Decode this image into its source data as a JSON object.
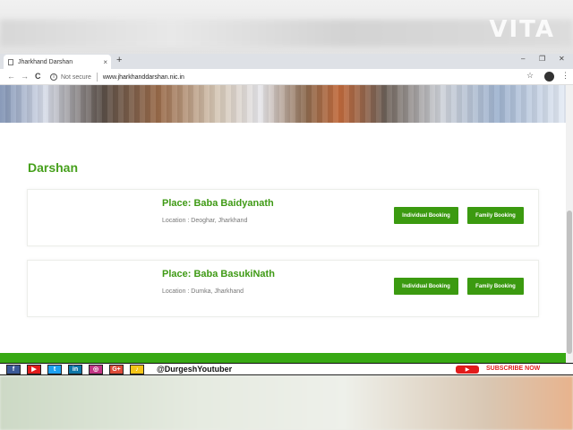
{
  "watermark": "VITA",
  "browser": {
    "tab_title": "Jharkhand Darshan",
    "tab_close": "×",
    "new_tab": "+",
    "win_min": "–",
    "win_max": "❐",
    "win_close": "✕",
    "back": "←",
    "forward": "→",
    "reload": "C",
    "info": "i",
    "security": "Not secure",
    "url": "www.jharkhanddarshan.nic.in",
    "bookmark": "☆",
    "menu": "⋮"
  },
  "page": {
    "section_title": "Darshan",
    "cards": [
      {
        "place": "Place: Baba Baidyanath",
        "location": "Location : Deoghar, Jharkhand",
        "individual_label": "Individual Booking",
        "family_label": "Family Booking"
      },
      {
        "place": "Place: Baba BasukiNath",
        "location": "Location : Dumka, Jharkhand",
        "individual_label": "Individual Booking",
        "family_label": "Family Booking"
      }
    ]
  },
  "social": {
    "icons": [
      {
        "name": "facebook-icon",
        "glyph": "f",
        "color": "#3b5998"
      },
      {
        "name": "youtube-icon",
        "glyph": "▶",
        "color": "#e21b1b"
      },
      {
        "name": "twitter-icon",
        "glyph": "t",
        "color": "#1da1f2"
      },
      {
        "name": "linkedin-icon",
        "glyph": "in",
        "color": "#0e76a8"
      },
      {
        "name": "instagram-icon",
        "glyph": "◎",
        "color": "#c13584"
      },
      {
        "name": "googleplus-icon",
        "glyph": "G+",
        "color": "#dd4b39"
      },
      {
        "name": "bell-icon",
        "glyph": "♪",
        "color": "#f5c518"
      }
    ],
    "handle": "@DurgeshYoutuber",
    "yt_glyph": "▶",
    "subscribe": "SUBSCRIBE NOW"
  }
}
